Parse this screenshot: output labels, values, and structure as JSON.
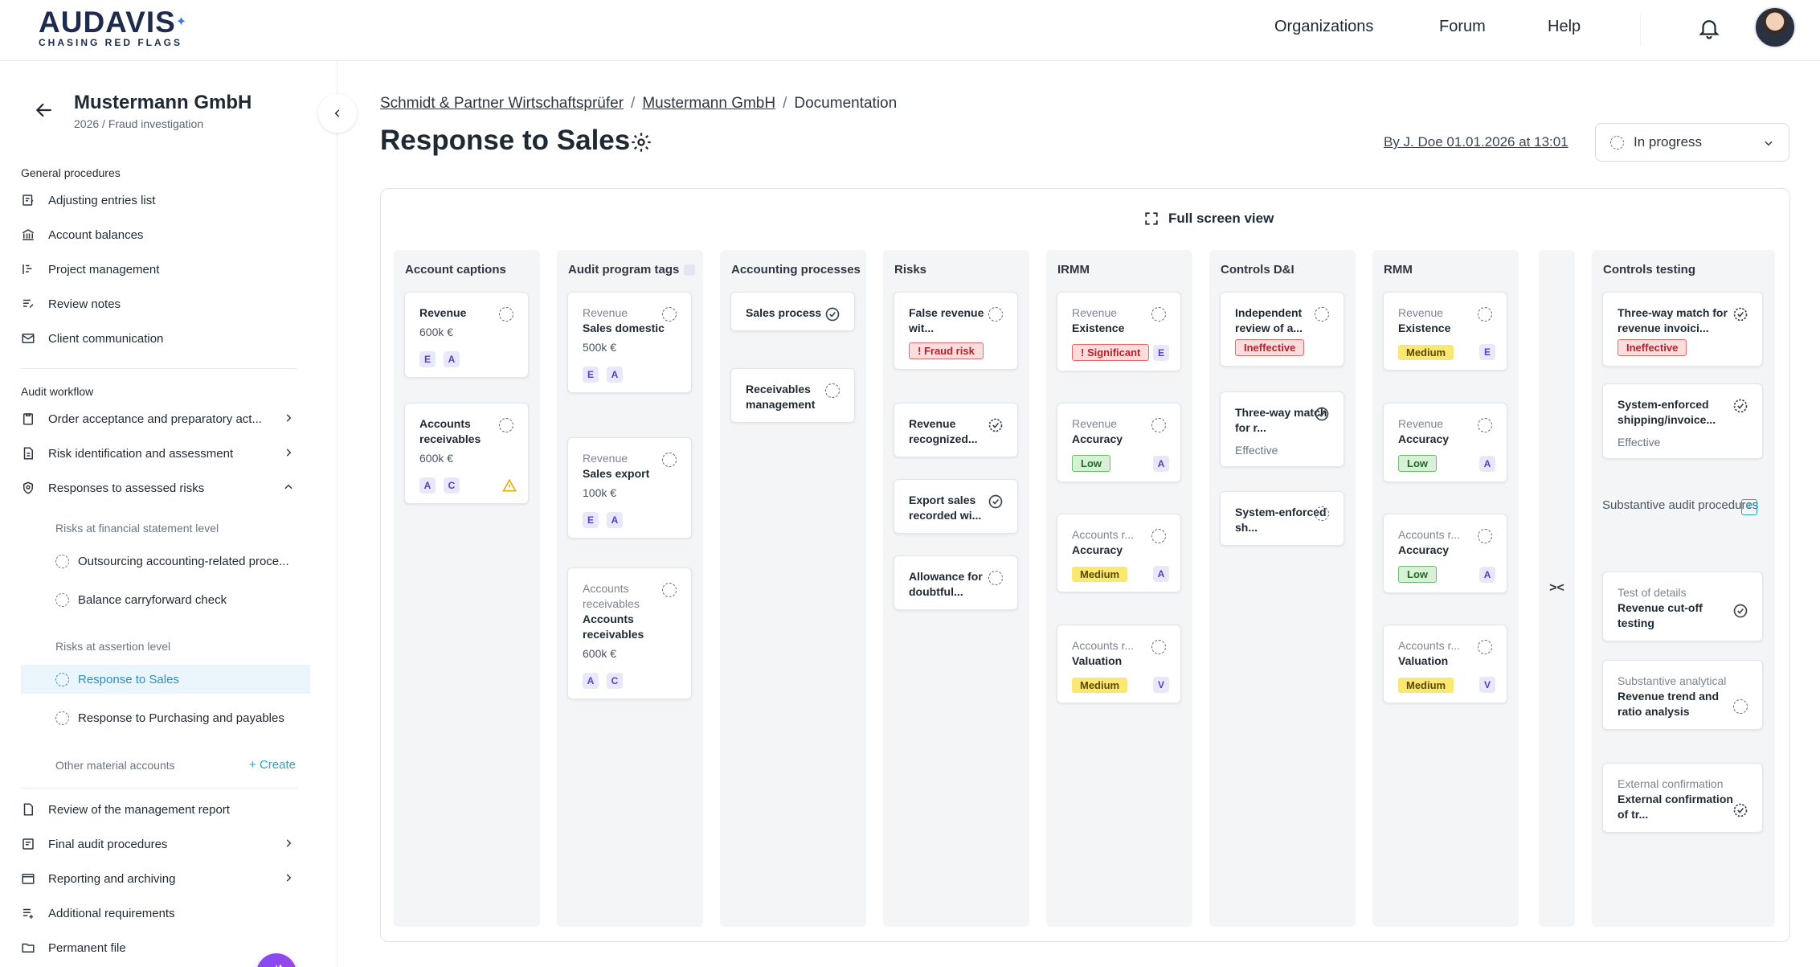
{
  "brand": {
    "name": "AUDAVIS",
    "tagline": "CHASING RED FLAGS"
  },
  "topnav": {
    "organizations": "Organizations",
    "forum": "Forum",
    "help": "Help"
  },
  "sidebar": {
    "company": "Mustermann GmbH",
    "subtitle": "2026 / Fraud investigation",
    "general_label": "General procedures",
    "general_items": [
      {
        "label": "Adjusting entries list",
        "icon": "list-edit-icon"
      },
      {
        "label": "Account balances",
        "icon": "bank-icon"
      },
      {
        "label": "Project management",
        "icon": "gantt-icon"
      },
      {
        "label": "Review notes",
        "icon": "notes-icon"
      },
      {
        "label": "Client communication",
        "icon": "mail-icon"
      }
    ],
    "workflow_label": "Audit workflow",
    "workflow_items": [
      {
        "label": "Order acceptance and preparatory act...",
        "icon": "clipboard-icon"
      },
      {
        "label": "Risk identification and assessment",
        "icon": "document-icon"
      },
      {
        "label": "Responses to assessed risks",
        "icon": "shield-search-icon"
      }
    ],
    "fs_level_label": "Risks at financial statement level",
    "fs_level_items": [
      "Outsourcing accounting-related proce...",
      "Balance carryforward check"
    ],
    "assertion_label": "Risks at assertion level",
    "assertion_items": [
      "Response to Sales",
      "Response to Purchasing and payables"
    ],
    "other_label": "Other material accounts",
    "create_label": "Create",
    "bottom_items": [
      {
        "label": "Review of the management report",
        "icon": "report-icon"
      },
      {
        "label": "Final audit procedures",
        "icon": "checklist-icon"
      },
      {
        "label": "Reporting and archiving",
        "icon": "archive-icon"
      },
      {
        "label": "Additional requirements",
        "icon": "list-plus-icon"
      },
      {
        "label": "Permanent file",
        "icon": "folder-icon"
      }
    ]
  },
  "breadcrumb": {
    "firm": "Schmidt & Partner Wirtschaftsprüfer",
    "client": "Mustermann GmbH",
    "current": "Documentation"
  },
  "page": {
    "title": "Response to Sales",
    "author": "By J. Doe 01.01.2026 at 13:01",
    "status": "In progress",
    "fullscreen": "Full screen view"
  },
  "columns": {
    "captions": {
      "title": "Account captions",
      "cards": [
        {
          "title": "Revenue",
          "value": "600k €",
          "tags": [
            "E",
            "A"
          ]
        },
        {
          "title": "Accounts receivables",
          "value": "600k €",
          "tags": [
            "A",
            "C"
          ]
        }
      ]
    },
    "tags": {
      "title": "Audit program tags",
      "cards": [
        {
          "kicker": "Revenue",
          "title": "Sales domestic",
          "value": "500k €",
          "tags": [
            "E",
            "A"
          ]
        },
        {
          "kicker": "Revenue",
          "title": "Sales export",
          "value": "100k €",
          "tags": [
            "E",
            "A"
          ]
        },
        {
          "kicker": "Accounts receivables",
          "title": "Accounts receivables",
          "value": "600k €",
          "tags": [
            "A",
            "C"
          ]
        }
      ]
    },
    "processes": {
      "title": "Accounting processes",
      "cards": [
        {
          "title": "Sales process"
        },
        {
          "title": "Receivables management"
        }
      ]
    },
    "risks": {
      "title": "Risks",
      "cards": [
        {
          "title": "False revenue wit...",
          "pill": "! Fraud risk"
        },
        {
          "title": "Revenue recognized..."
        },
        {
          "title": "Export sales recorded wi..."
        },
        {
          "title": "Allowance for doubtful..."
        }
      ]
    },
    "irmm": {
      "title": "IRMM",
      "cards": [
        {
          "kicker": "Revenue",
          "title": "Existence",
          "pill": "! Significant",
          "tag": "E"
        },
        {
          "kicker": "Revenue",
          "title": "Accuracy",
          "pill": "Low",
          "tag": "A"
        },
        {
          "kicker": "Accounts r...",
          "title": "Accuracy",
          "pill": "Medium",
          "tag": "A"
        },
        {
          "kicker": "Accounts r...",
          "title": "Valuation",
          "pill": "Medium",
          "tag": "V"
        }
      ]
    },
    "controls_di": {
      "title": "Controls D&I",
      "cards": [
        {
          "title": "Independent review of a...",
          "pill": "Ineffective"
        },
        {
          "title": "Three-way match for r...",
          "status": "Effective"
        },
        {
          "title": "System-enforced sh..."
        }
      ]
    },
    "rmm": {
      "title": "RMM",
      "cards": [
        {
          "kicker": "Revenue",
          "title": "Existence",
          "pill": "Medium",
          "tag": "E"
        },
        {
          "kicker": "Revenue",
          "title": "Accuracy",
          "pill": "Low",
          "tag": "A"
        },
        {
          "kicker": "Accounts r...",
          "title": "Accuracy",
          "pill": "Low",
          "tag": "A"
        },
        {
          "kicker": "Accounts r...",
          "title": "Valuation",
          "pill": "Medium",
          "tag": "V"
        }
      ]
    },
    "collapse_glyph": "><",
    "testing": {
      "title": "Controls testing",
      "cards": [
        {
          "title": "Three-way match for revenue invoici...",
          "pill": "Ineffective"
        },
        {
          "title": "System-enforced shipping/invoice...",
          "status": "Effective"
        }
      ],
      "substantive_label": "Substantive audit procedures",
      "substantive_cards": [
        {
          "kicker": "Test of details",
          "title": "Revenue cut-off testing"
        },
        {
          "kicker": "Substantive analytical",
          "title": "Revenue trend and ratio analysis"
        },
        {
          "kicker": "External confirmation",
          "title": "External confirmation of tr..."
        }
      ]
    }
  }
}
